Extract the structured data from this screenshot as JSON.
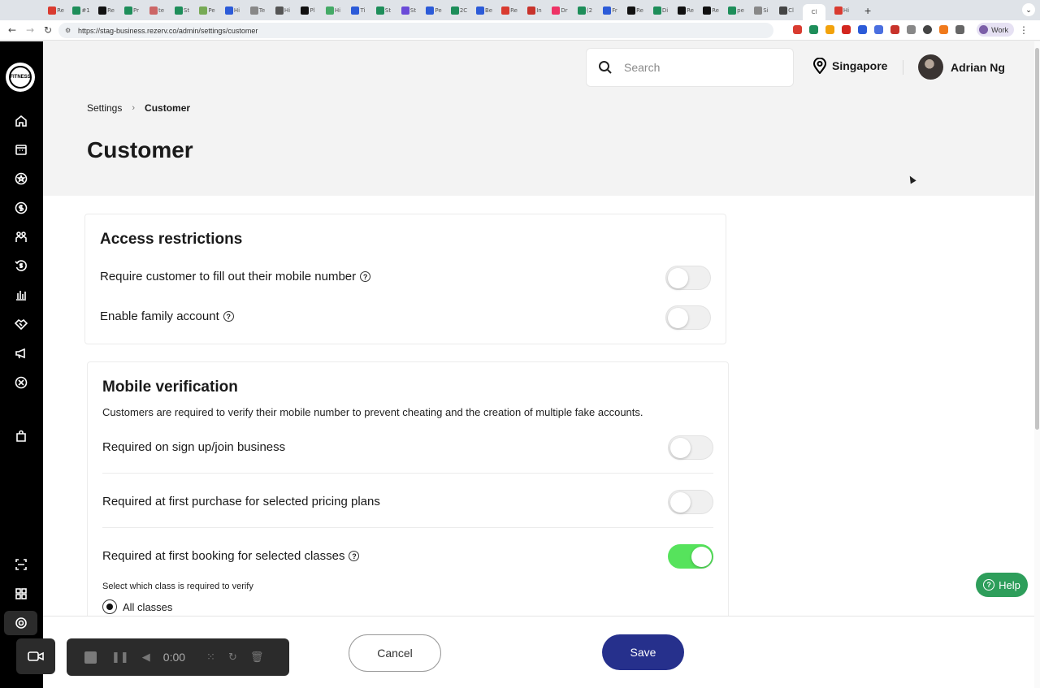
{
  "browser": {
    "url": "https://stag-business.rezerv.co/admin/settings/customer",
    "profile_label": "Work",
    "tabs": [
      "Re",
      "#1",
      "Re",
      "Pr",
      "te",
      "St",
      "Pe",
      "Hi",
      "Te",
      "Hi",
      "Pl",
      "Hi",
      "Ti",
      "St",
      "St",
      "Pe",
      "2C",
      "Be",
      "Re",
      "In",
      "Dr",
      "(2",
      "Fr",
      "Re",
      "Di",
      "Re",
      "Re",
      "pe",
      "Si",
      "Cl",
      "Hi"
    ],
    "active_tab": "Hi",
    "active_tab_label": "Cl"
  },
  "header": {
    "search_placeholder": "Search",
    "location": "Singapore",
    "user_name": "Adrian Ng"
  },
  "logo": {
    "text": "FITNESS"
  },
  "breadcrumb": {
    "parent": "Settings",
    "separator": "›",
    "current": "Customer"
  },
  "page_title": "Customer",
  "access_restrictions": {
    "title": "Access restrictions",
    "rows": [
      {
        "label": "Require customer to fill out their mobile number",
        "enabled": false,
        "has_info": true
      },
      {
        "label": "Enable family account",
        "enabled": false,
        "has_info": true
      }
    ]
  },
  "mobile_verification": {
    "title": "Mobile verification",
    "description": "Customers are required to verify their mobile number to prevent cheating and the creation of multiple fake accounts.",
    "rows": [
      {
        "label": "Required on sign up/join business",
        "enabled": false
      },
      {
        "label": "Required at first purchase for selected pricing plans",
        "enabled": false
      },
      {
        "label": "Required at first booking for selected classes",
        "enabled": true,
        "has_info": true
      }
    ],
    "class_select_label": "Select which class is required to verify",
    "class_option": "All classes"
  },
  "footer": {
    "cancel": "Cancel",
    "save": "Save"
  },
  "help": {
    "label": "Help"
  },
  "recorder": {
    "time": "0:00"
  },
  "colors": {
    "sidebar": "#000000",
    "primary_button": "#26308c",
    "toggle_on": "#56e35c",
    "help_button": "#2e9e5b"
  }
}
